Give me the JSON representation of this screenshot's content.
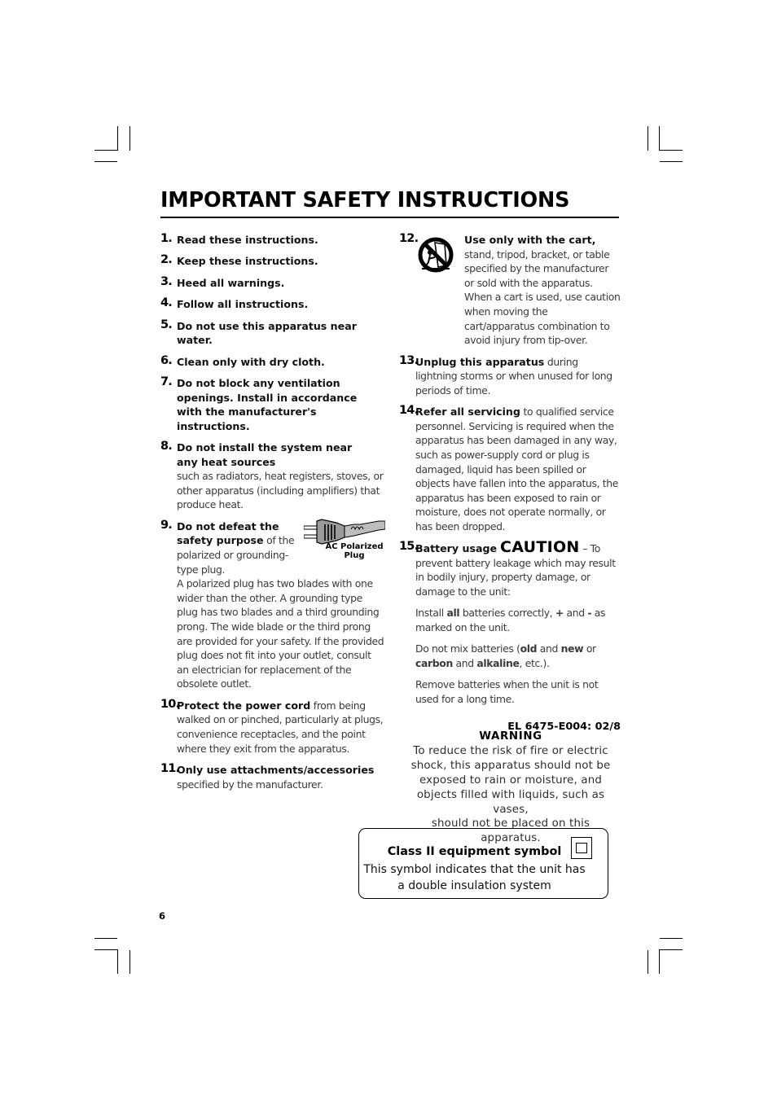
{
  "header": {
    "title": "IMPORTANT SAFETY INSTRUCTIONS"
  },
  "left_column": {
    "items": [
      {
        "num": "1.",
        "bold": "Read these instructions."
      },
      {
        "num": "2.",
        "bold": "Keep these instructions."
      },
      {
        "num": "3.",
        "bold": "Heed all warnings."
      },
      {
        "num": "4.",
        "bold": "Follow all instructions."
      },
      {
        "num": "5.",
        "bold": "Do not use this apparatus near water."
      },
      {
        "num": "6.",
        "bold": "Clean only with dry cloth."
      },
      {
        "num": "7.",
        "bold": "Do not block any ventilation openings. Install in accordance with the manufacturer's instructions."
      },
      {
        "num": "8.",
        "bold": "Do not install the system near any heat sources",
        "text": "such as radiators, heat registers, stoves, or other apparatus (including amplifiers) that produce heat."
      },
      {
        "num": "9.",
        "bold": "Do not defeat the safety purpose",
        "text_inline": " of the polarized or grounding-type plug.",
        "text": "A polarized plug has two blades with one wider than the other. A grounding type plug has two blades and a third grounding prong. The wide blade or the third prong are provided for your safety. If the provided plug does not fit into your outlet, consult an electrician for replacement of the obsolete outlet.",
        "image_label": "AC Polarized Plug",
        "image_icon": "ac-polarized-plug-icon"
      },
      {
        "num": "10.",
        "bold": "Protect the power cord",
        "text": " from being walked on or pinched, particularly at plugs, convenience receptacles, and the point where they exit from the apparatus."
      },
      {
        "num": "11.",
        "bold": "Only use attachments/accessories",
        "text": "specified by the manufacturer."
      }
    ]
  },
  "right_column": {
    "items": [
      {
        "num": "12.",
        "bold": "Use only with the cart,",
        "text": " stand, tripod, bracket, or table specified by the manufacturer or sold with the apparatus. When a cart is used, use caution when moving the cart/apparatus combination to avoid injury from tip-over.",
        "image_icon": "cart-tip-over-warning-icon"
      },
      {
        "num": "13.",
        "bold": "Unplug this apparatus",
        "text": " during lightning storms or when unused for long periods of time."
      },
      {
        "num": "14.",
        "bold": "Refer all servicing",
        "text": " to qualified service personnel. Servicing is required when the apparatus has been damaged in any way, such as power-supply cord or plug is damaged, liquid has been spilled or objects have fallen into the apparatus, the apparatus has been exposed to rain or moisture, does not operate normally, or has been dropped."
      },
      {
        "num": "15.",
        "bold": "Battery usage",
        "caution": "CAUTION",
        "text": " – To prevent battery leakage which may result in bodily injury, property damage, or damage to the unit:"
      }
    ],
    "battery_notes": {
      "install": {
        "a": "Install ",
        "b1": "all",
        "c": " batteries correctly, ",
        "b2": "+",
        "d": " and ",
        "b3": "-",
        "e": " as marked on the unit."
      },
      "mix": {
        "a": "Do not mix batteries (",
        "b1": "old",
        "c": " and ",
        "b2": "new",
        "d": " or ",
        "b3": "carbon",
        "e": " and ",
        "b4": "alkaline",
        "f": ", etc.)."
      },
      "remove": "Remove batteries when the unit is not used for a long time."
    },
    "code": "EL 6475-E004: 02/8"
  },
  "warning": {
    "heading": "WARNING",
    "lines": [
      "To reduce the risk of fire or electric",
      "shock, this apparatus should not be",
      "exposed to rain or moisture, and",
      "objects filled with liquids, such as vases,",
      "should not be placed on this apparatus."
    ]
  },
  "class_box": {
    "title": "Class II equipment symbol",
    "line1": "This symbol indicates that the unit has",
    "line2": "a double insulation system",
    "icon": "double-square-class-ii-icon"
  },
  "page_number": "6"
}
